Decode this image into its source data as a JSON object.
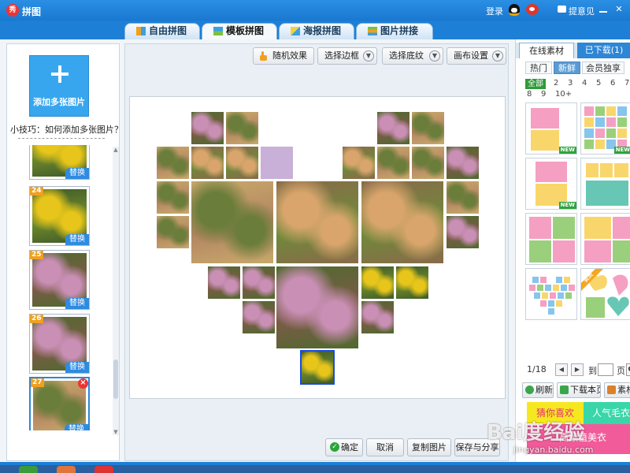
{
  "app": {
    "logo_text": "秀",
    "title": "拼图"
  },
  "titlebar": {
    "login": "登录",
    "feedback": "提意见"
  },
  "tabs": [
    {
      "label": "自由拼图",
      "active": false
    },
    {
      "label": "模板拼图",
      "active": true
    },
    {
      "label": "海报拼图",
      "active": false
    },
    {
      "label": "图片拼接",
      "active": false
    }
  ],
  "left": {
    "add_label": "添加多张图片",
    "tip": "小技巧：如何添加多张图片？",
    "replace_label": "替换",
    "thumbs": [
      {
        "number": "",
        "photo": "forsythia",
        "selected": false
      },
      {
        "number": "24",
        "photo": "forsythia",
        "selected": false
      },
      {
        "number": "25",
        "photo": "blossom",
        "selected": false
      },
      {
        "number": "26",
        "photo": "blossom",
        "selected": false
      },
      {
        "number": "27",
        "photo": "garden",
        "selected": true
      }
    ]
  },
  "toolbar": {
    "random": "随机效果",
    "border": "选择边框",
    "background": "选择底纹",
    "canvas": "画布设置"
  },
  "actions": {
    "confirm": "确定",
    "cancel": "取消",
    "copy": "复制图片",
    "save_share": "保存与分享"
  },
  "right": {
    "tab_online": "在线素材",
    "tab_downloaded": "已下载(1)",
    "filters": [
      "热门",
      "新鲜",
      "会员独享"
    ],
    "active_filter": "新鲜",
    "counts": [
      "全部",
      "2",
      "3",
      "4",
      "5",
      "6",
      "7",
      "8",
      "9",
      "10+"
    ],
    "new_badge": "NEW",
    "page_indicator": "1/18",
    "goto": "到",
    "page_unit": "页",
    "go": "GO",
    "refresh": "刷新",
    "download_page": "下载本页",
    "material": "素材",
    "ads": [
      "猜你喜欢",
      "人气毛衣",
      "高颜值美衣"
    ],
    "hot_badge": "会员"
  },
  "watermark": {
    "text": "Bai度经验",
    "url": "jingyan.baidu.com"
  },
  "colors": {
    "accent": "#1d7fd6",
    "photo_palette": {
      "forsythia": [
        "#e7c51a",
        "#6f8a2a",
        "#3f5a2a"
      ],
      "blossom": [
        "#c98fb5",
        "#7d5a48",
        "#4f6a2e"
      ],
      "garden": [
        "#6a7d3a",
        "#b48463",
        "#c7a96a"
      ],
      "building": [
        "#d9a56c",
        "#6e8a3a",
        "#8a6a4a"
      ],
      "placeholder": [
        "#c8b0d8",
        "#c8b0d8",
        "#c8b0d8"
      ]
    }
  }
}
